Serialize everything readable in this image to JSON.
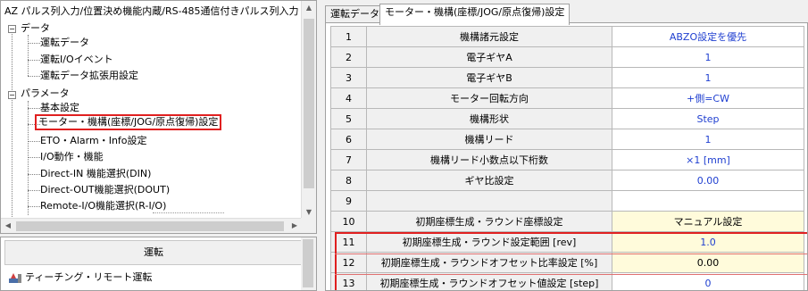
{
  "tree": {
    "title": "AZ パルス列入力/位置決め機能内蔵/RS-485通信付きパルス列入力",
    "nodes": [
      {
        "label": "データ",
        "expanded": true,
        "children": [
          "運転データ",
          "運転I/Oイベント",
          "運転データ拡張用設定"
        ]
      },
      {
        "label": "パラメータ",
        "expanded": true,
        "children": [
          "基本設定",
          "モーター・機構(座標/JOG/原点復帰)設定",
          "ETO・Alarm・Info設定",
          "I/O動作・機能",
          "Direct-IN 機能選択(DIN)",
          "Direct-OUT機能選択(DOUT)",
          "Remote-I/O機能選択(R-I/O)"
        ]
      }
    ],
    "selected": "モーター・機構(座標/JOG/原点復帰)設定"
  },
  "run_panel": {
    "header": "運転",
    "item": "ティーチング・リモート運転"
  },
  "tabs": [
    "運転データ",
    "モーター・機構(座標/JOG/原点復帰)設定"
  ],
  "active_tab": 1,
  "grid": {
    "rows": [
      {
        "no": "1",
        "name": "機構諸元設定",
        "value": "ABZO設定を優先"
      },
      {
        "no": "2",
        "name": "電子ギヤA",
        "value": "1"
      },
      {
        "no": "3",
        "name": "電子ギヤB",
        "value": "1"
      },
      {
        "no": "4",
        "name": "モーター回転方向",
        "value": "+側=CW"
      },
      {
        "no": "5",
        "name": "機構形状",
        "value": "Step"
      },
      {
        "no": "6",
        "name": "機構リード",
        "value": "1"
      },
      {
        "no": "7",
        "name": "機構リード小数点以下桁数",
        "value": "×1 [mm]"
      },
      {
        "no": "8",
        "name": "ギヤ比設定",
        "value": "0.00"
      },
      {
        "no": "9",
        "name": "",
        "value": ""
      },
      {
        "no": "10",
        "name": "初期座標生成・ラウンド座標設定",
        "value": "マニュアル設定"
      },
      {
        "no": "11",
        "name": "初期座標生成・ラウンド設定範囲 [rev]",
        "value": "1.0"
      },
      {
        "no": "12",
        "name": "初期座標生成・ラウンドオフセット比率設定 [%]",
        "value": "0.00"
      },
      {
        "no": "13",
        "name": "初期座標生成・ラウンドオフセット値設定 [step]",
        "value": "0"
      }
    ]
  },
  "colors": {
    "value_text": "#1f3fd0",
    "highlight_bg": "#fffbdb",
    "selection_border": "#e02020"
  }
}
